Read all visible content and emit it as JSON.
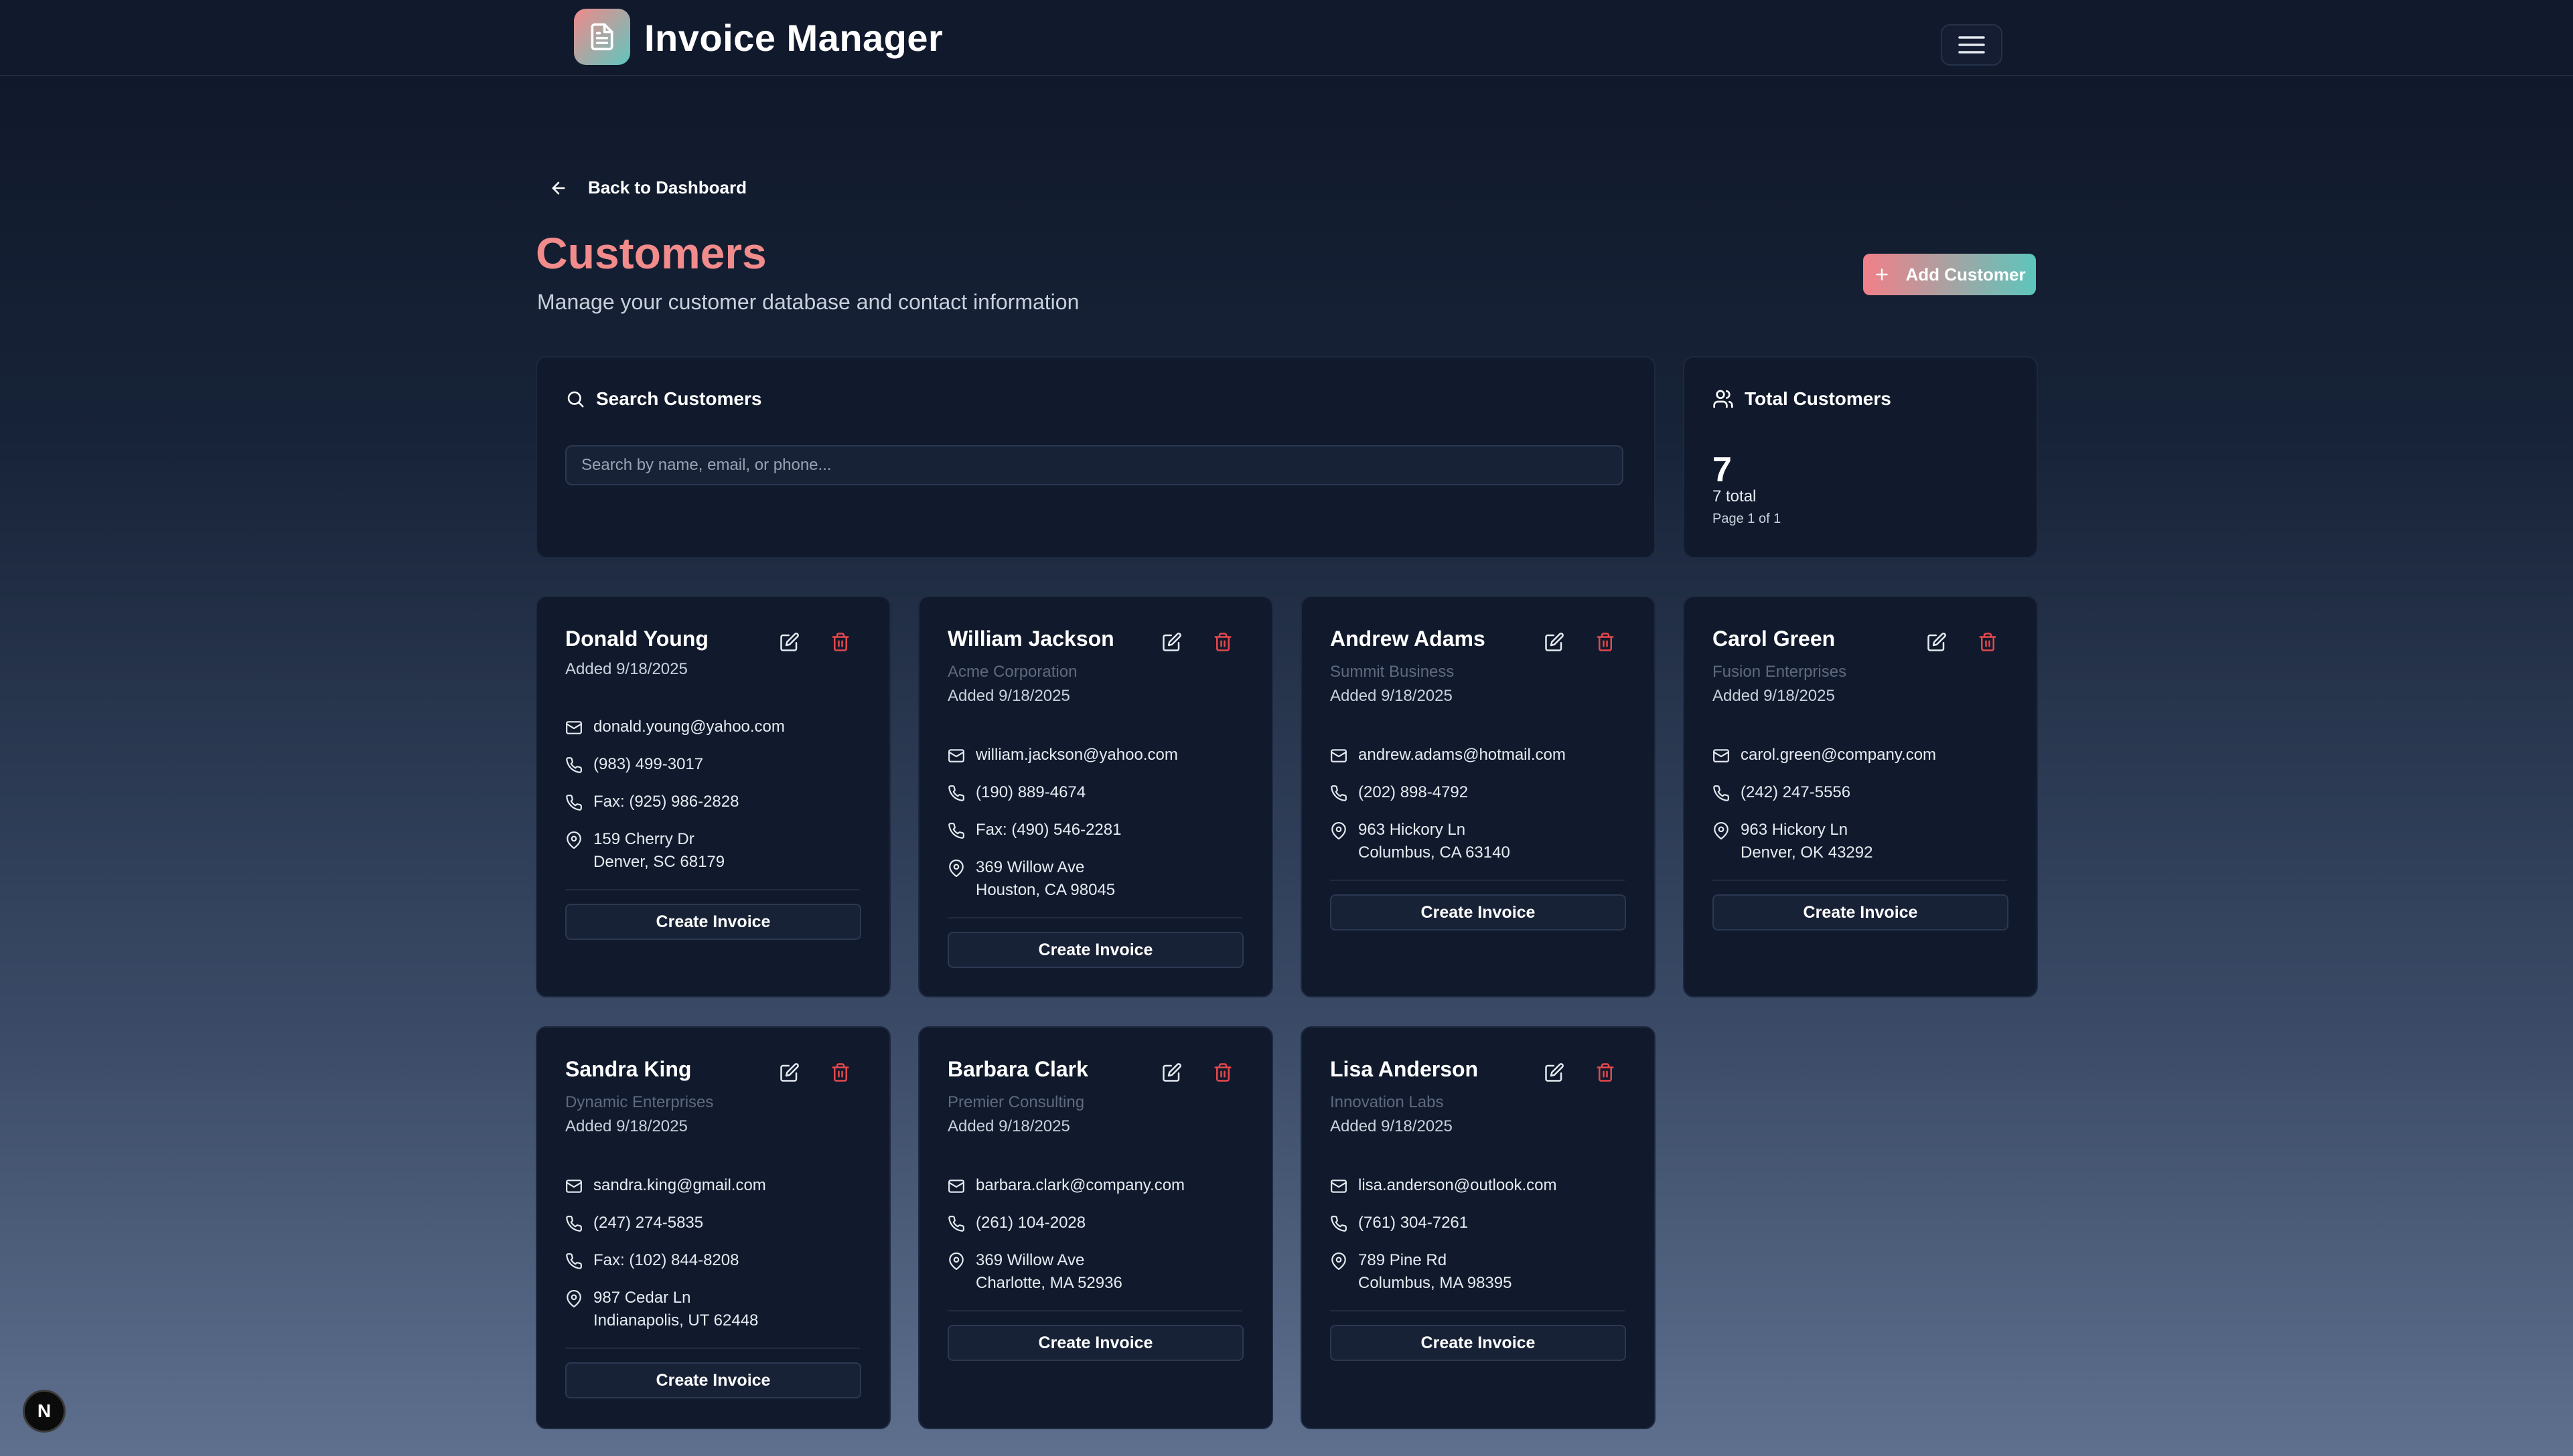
{
  "app": {
    "title": "Invoice Manager",
    "logo_icon": "document-icon",
    "menu_icon": "hamburger-icon"
  },
  "nav": {
    "back_label": "Back to Dashboard"
  },
  "header": {
    "title": "Customers",
    "subtitle": "Manage your customer database and contact information",
    "add_button_label": "Add Customer"
  },
  "search": {
    "title": "Search Customers",
    "placeholder": "Search by name, email, or phone..."
  },
  "totals": {
    "title": "Total Customers",
    "count": "7",
    "total_label": "7 total",
    "page_label": "Page 1 of 1"
  },
  "colors": {
    "accent": "#f28b8b",
    "teal": "#5fc6bf",
    "danger": "#e5484d",
    "card_bg": "#111a2c"
  },
  "customers": [
    {
      "name": "Donald Young",
      "company": "",
      "added": "Added 9/18/2025",
      "email": "donald.young@yahoo.com",
      "phone": "(983) 499-3017",
      "fax": "Fax: (925) 986-2828",
      "address_line1": "159 Cherry Dr",
      "address_line2": "Denver, SC 68179",
      "button_label": "Create Invoice"
    },
    {
      "name": "William Jackson",
      "company": "Acme Corporation",
      "added": "Added 9/18/2025",
      "email": "william.jackson@yahoo.com",
      "phone": "(190) 889-4674",
      "fax": "Fax: (490) 546-2281",
      "address_line1": "369 Willow Ave",
      "address_line2": "Houston, CA 98045",
      "button_label": "Create Invoice"
    },
    {
      "name": "Andrew Adams",
      "company": "Summit Business",
      "added": "Added 9/18/2025",
      "email": "andrew.adams@hotmail.com",
      "phone": "(202) 898-4792",
      "fax": "",
      "address_line1": "963 Hickory Ln",
      "address_line2": "Columbus, CA 63140",
      "button_label": "Create Invoice"
    },
    {
      "name": "Carol Green",
      "company": "Fusion Enterprises",
      "added": "Added 9/18/2025",
      "email": "carol.green@company.com",
      "phone": "(242) 247-5556",
      "fax": "",
      "address_line1": "963 Hickory Ln",
      "address_line2": "Denver, OK 43292",
      "button_label": "Create Invoice"
    },
    {
      "name": "Sandra King",
      "company": "Dynamic Enterprises",
      "added": "Added 9/18/2025",
      "email": "sandra.king@gmail.com",
      "phone": "(247) 274-5835",
      "fax": "Fax: (102) 844-8208",
      "address_line1": "987 Cedar Ln",
      "address_line2": "Indianapolis, UT 62448",
      "button_label": "Create Invoice"
    },
    {
      "name": "Barbara Clark",
      "company": "Premier Consulting",
      "added": "Added 9/18/2025",
      "email": "barbara.clark@company.com",
      "phone": "(261) 104-2028",
      "fax": "",
      "address_line1": "369 Willow Ave",
      "address_line2": "Charlotte, MA 52936",
      "button_label": "Create Invoice"
    },
    {
      "name": "Lisa Anderson",
      "company": "Innovation Labs",
      "added": "Added 9/18/2025",
      "email": "lisa.anderson@outlook.com",
      "phone": "(761) 304-7261",
      "fax": "",
      "address_line1": "789 Pine Rd",
      "address_line2": "Columbus, MA 98395",
      "button_label": "Create Invoice"
    }
  ],
  "dev_badge": {
    "label": "N"
  }
}
